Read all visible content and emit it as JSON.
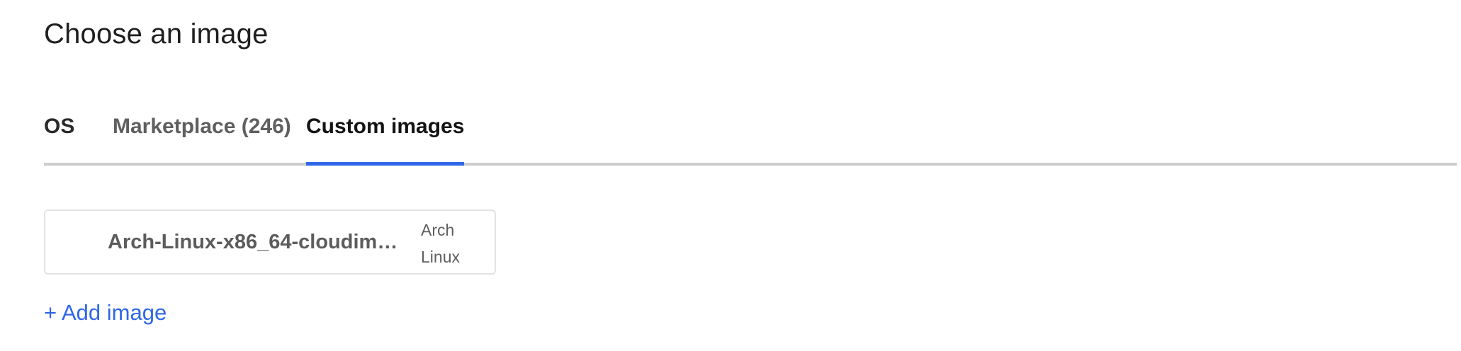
{
  "page": {
    "title": "Choose an image"
  },
  "tabs": [
    {
      "label": "OS",
      "active": false
    },
    {
      "label": "Marketplace (246)",
      "active": false
    },
    {
      "label": "Custom images",
      "active": true
    }
  ],
  "custom_images": [
    {
      "name": "Arch-Linux-x86_64-cloudim…",
      "distribution_line1": "Arch",
      "distribution_line2": "Linux"
    }
  ],
  "add_image_label": "+ Add image",
  "colors": {
    "accent": "#2f67e6",
    "tab_rule": "#cccccc",
    "card_border": "#e3e3e3"
  }
}
